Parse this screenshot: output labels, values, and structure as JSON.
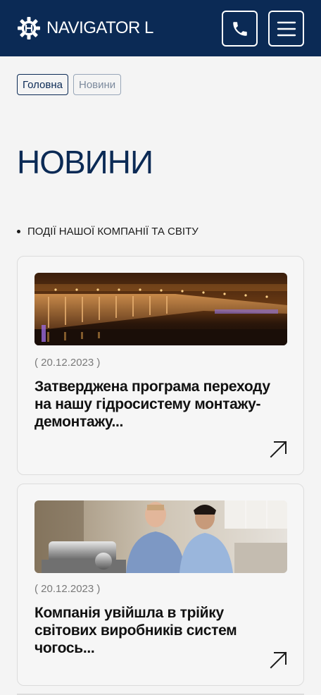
{
  "header": {
    "brand": "NAVIGATOR L",
    "logo_icon": "gear-logo-icon",
    "call_icon": "phone-icon",
    "menu_icon": "hamburger-menu-icon",
    "background": "#0b2a55"
  },
  "breadcrumb": {
    "items": [
      {
        "label": "Головна"
      },
      {
        "label": "Новини"
      }
    ]
  },
  "page": {
    "title": "НОВИНИ",
    "section_label": "ПОДІЇ НАШОЇ КОМПАНІЇ ТА СВІТУ"
  },
  "news": [
    {
      "date": "( 20.12.2023 )",
      "title": "Затверджена програма переходу на нашу гідросистему монтажу-демонтажу...",
      "image": "hydroelectric-dam-at-night",
      "arrow_icon": "arrow-up-right-icon"
    },
    {
      "date": "( 20.12.2023 )",
      "title": "Компанія увійшла в трійку світових виробників систем чогось...",
      "image": "engineers-with-equipment",
      "arrow_icon": "arrow-up-right-icon"
    }
  ]
}
